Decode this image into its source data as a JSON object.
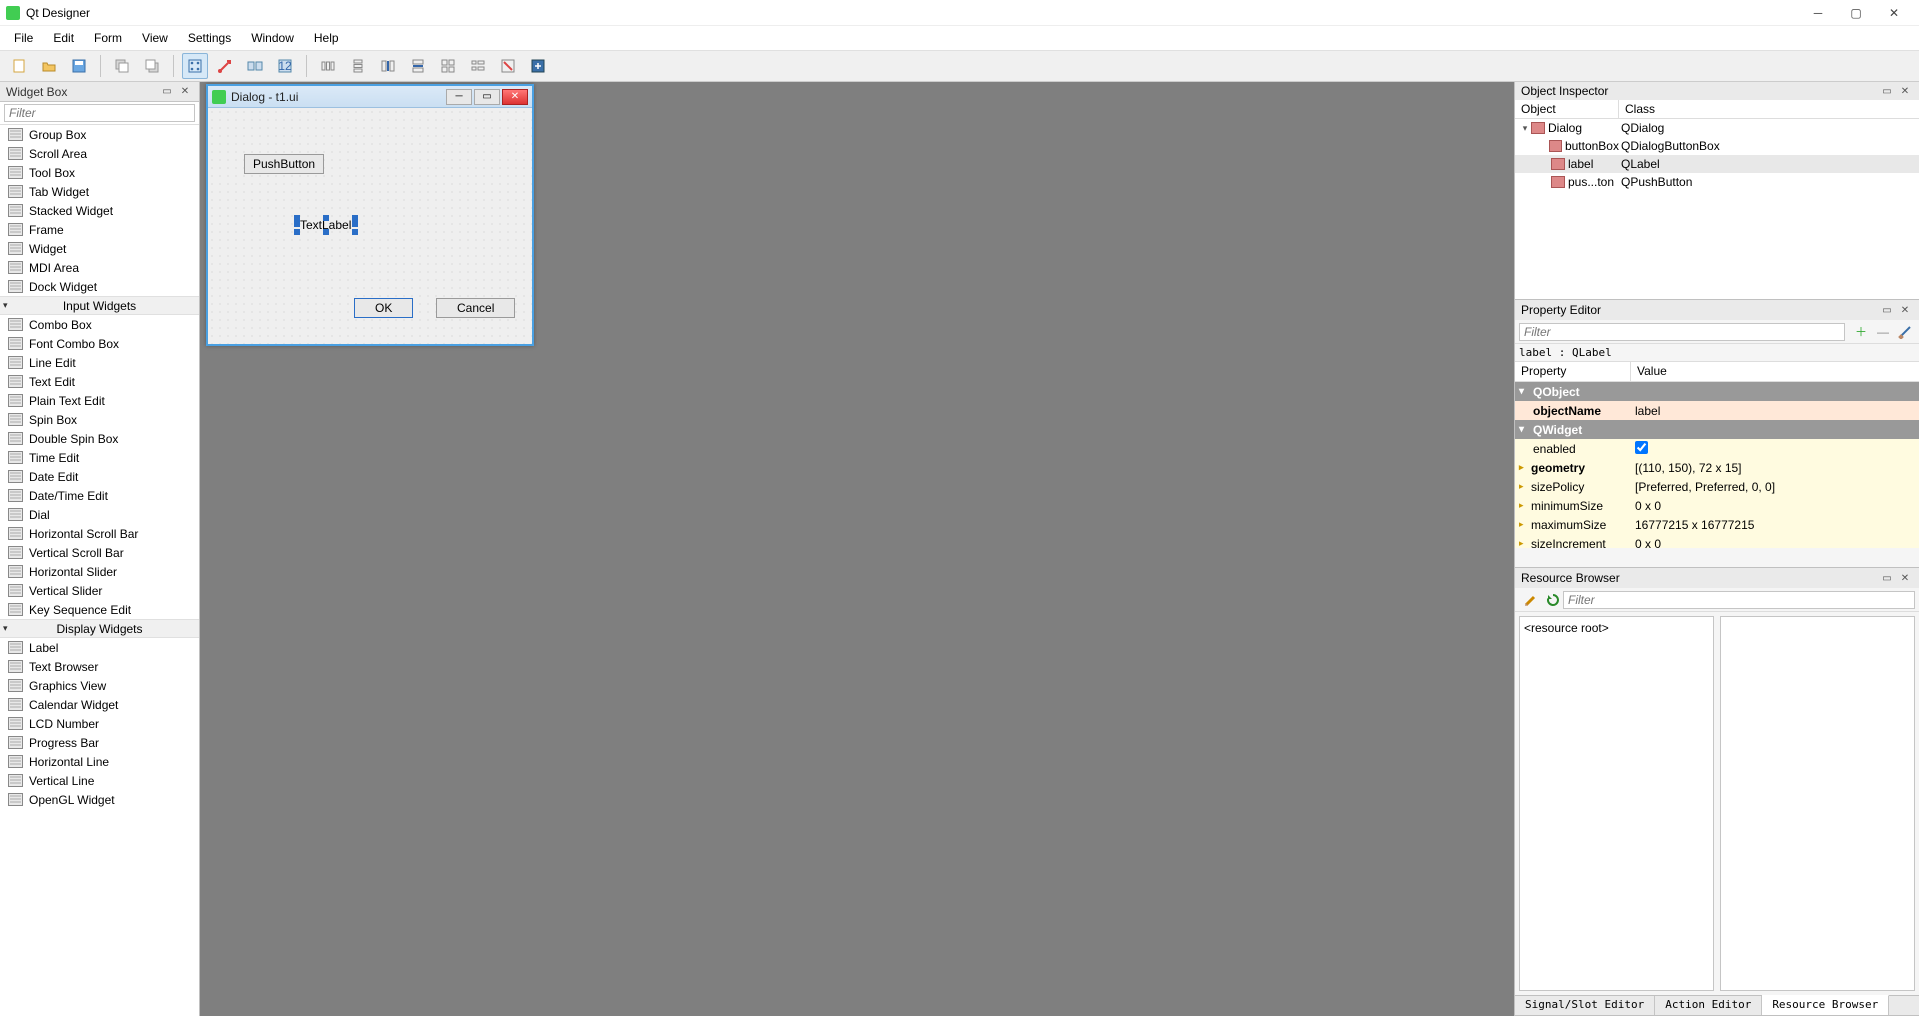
{
  "window": {
    "title": "Qt Designer"
  },
  "menu": [
    "File",
    "Edit",
    "Form",
    "View",
    "Settings",
    "Window",
    "Help"
  ],
  "widget_box": {
    "title": "Widget Box",
    "filter_placeholder": "Filter",
    "items_top": [
      "Group Box",
      "Scroll Area",
      "Tool Box",
      "Tab Widget",
      "Stacked Widget",
      "Frame",
      "Widget",
      "MDI Area",
      "Dock Widget"
    ],
    "cat_input": "Input Widgets",
    "items_input": [
      "Combo Box",
      "Font Combo Box",
      "Line Edit",
      "Text Edit",
      "Plain Text Edit",
      "Spin Box",
      "Double Spin Box",
      "Time Edit",
      "Date Edit",
      "Date/Time Edit",
      "Dial",
      "Horizontal Scroll Bar",
      "Vertical Scroll Bar",
      "Horizontal Slider",
      "Vertical Slider",
      "Key Sequence Edit"
    ],
    "cat_display": "Display Widgets",
    "items_display": [
      "Label",
      "Text Browser",
      "Graphics View",
      "Calendar Widget",
      "LCD Number",
      "Progress Bar",
      "Horizontal Line",
      "Vertical Line",
      "OpenGL Widget"
    ]
  },
  "mdi": {
    "title": "Dialog - t1.ui",
    "pushbutton": "PushButton",
    "label": "TextLabel",
    "ok": "OK",
    "cancel": "Cancel"
  },
  "object_inspector": {
    "title": "Object Inspector",
    "col_object": "Object",
    "col_class": "Class",
    "rows": [
      {
        "name": "Dialog",
        "cls": "QDialog",
        "depth": 0,
        "exp": true
      },
      {
        "name": "buttonBox",
        "cls": "QDialogButtonBox",
        "depth": 1
      },
      {
        "name": "label",
        "cls": "QLabel",
        "depth": 1,
        "selected": true
      },
      {
        "name": "pus...ton",
        "cls": "QPushButton",
        "depth": 1
      }
    ]
  },
  "property_editor": {
    "title": "Property Editor",
    "filter_placeholder": "Filter",
    "caption": "label : QLabel",
    "col_prop": "Property",
    "col_val": "Value",
    "rows": [
      {
        "type": "group",
        "label": "QObject"
      },
      {
        "type": "row",
        "k": "objectName",
        "v": "label",
        "style": "peach",
        "bold": true
      },
      {
        "type": "group",
        "label": "QWidget"
      },
      {
        "type": "row",
        "k": "enabled",
        "v": "",
        "checkbox": true,
        "style": "yellow"
      },
      {
        "type": "row",
        "k": "geometry",
        "v": "[(110, 150), 72 x 15]",
        "style": "yellow",
        "bold": true,
        "expandable": true
      },
      {
        "type": "row",
        "k": "sizePolicy",
        "v": "[Preferred, Preferred, 0, 0]",
        "style": "yellow",
        "expandable": true
      },
      {
        "type": "row",
        "k": "minimumSize",
        "v": "0 x 0",
        "style": "yellow",
        "expandable": true
      },
      {
        "type": "row",
        "k": "maximumSize",
        "v": "16777215 x 16777215",
        "style": "yellow",
        "expandable": true
      },
      {
        "type": "row",
        "k": "sizeIncrement",
        "v": "0 x 0",
        "style": "yellow",
        "expandable": true
      }
    ]
  },
  "resource_browser": {
    "title": "Resource Browser",
    "filter_placeholder": "Filter",
    "root": "<resource root>",
    "tabs": [
      "Signal/Slot Editor",
      "Action Editor",
      "Resource Browser"
    ],
    "active_tab": 2
  }
}
